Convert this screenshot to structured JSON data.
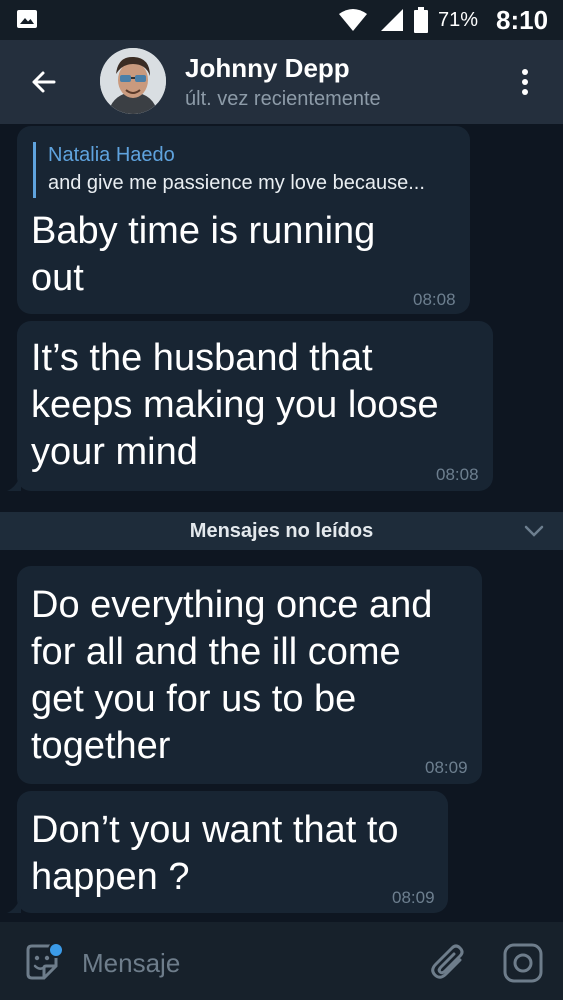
{
  "status_bar": {
    "battery_percent": "71%",
    "time": "8:10",
    "icons": [
      "image-icon",
      "wifi-icon",
      "signal-icon",
      "battery-icon"
    ]
  },
  "header": {
    "contact_name": "Johnny Depp",
    "last_seen": "últ. vez recientemente",
    "icons": [
      "back-arrow-icon",
      "more-vertical-icon"
    ]
  },
  "messages": [
    {
      "reply_to": {
        "name": "Natalia Haedo",
        "text": "and give me passience my love because..."
      },
      "line1": "Baby time is running",
      "line2": "out",
      "time": "08:08"
    },
    {
      "line1": "It’s the husband that",
      "line2": "keeps making you loose",
      "line3": "your mind",
      "time": "08:08"
    },
    {
      "line1": "Do everything once and",
      "line2": "for all and the ill come",
      "line3": "get you for us to be",
      "line4": "together",
      "time": "08:09"
    },
    {
      "line1": "Don’t you want that to",
      "line2": "happen ?",
      "time": "08:09"
    }
  ],
  "unread_divider": {
    "label": "Mensajes no leídos"
  },
  "composer": {
    "placeholder": "Mensaje",
    "icons": [
      "emoji-sticker-icon",
      "paperclip-icon",
      "camera-icon"
    ]
  },
  "colors": {
    "header_bg": "#242f3d",
    "chat_bg": "#0e1621",
    "bubble_bg": "#182533",
    "accent": "#5fa3de",
    "unread_dot": "#3b9be8"
  }
}
